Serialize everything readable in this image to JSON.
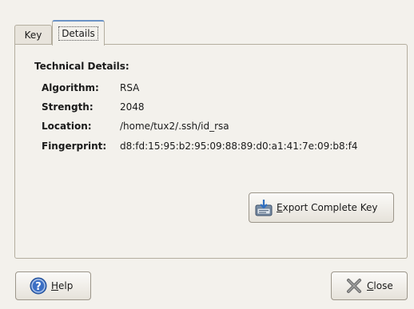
{
  "tabs": {
    "key": "Key",
    "details": "Details"
  },
  "details": {
    "title": "Technical Details:",
    "rows": [
      {
        "label": "Algorithm:",
        "value": "RSA"
      },
      {
        "label": "Strength:",
        "value": "2048"
      },
      {
        "label": "Location:",
        "value": "/home/tux2/.ssh/id_rsa"
      },
      {
        "label": "Fingerprint:",
        "value": "d8:fd:15:95:b2:95:09:88:89:d0:a1:41:7e:09:b8:f4"
      }
    ]
  },
  "buttons": {
    "export": {
      "mnemonic": "E",
      "label_after": "xport Complete Key",
      "icon": "export-key-icon"
    },
    "help": {
      "mnemonic": "H",
      "label_after": "elp",
      "icon": "help-icon"
    },
    "close": {
      "mnemonic": "C",
      "label_after": "lose",
      "icon": "close-x-icon"
    }
  },
  "colors": {
    "background": "#f3f1ec",
    "border": "#b4ae9f",
    "active_tab_accent": "#6b93c6"
  }
}
